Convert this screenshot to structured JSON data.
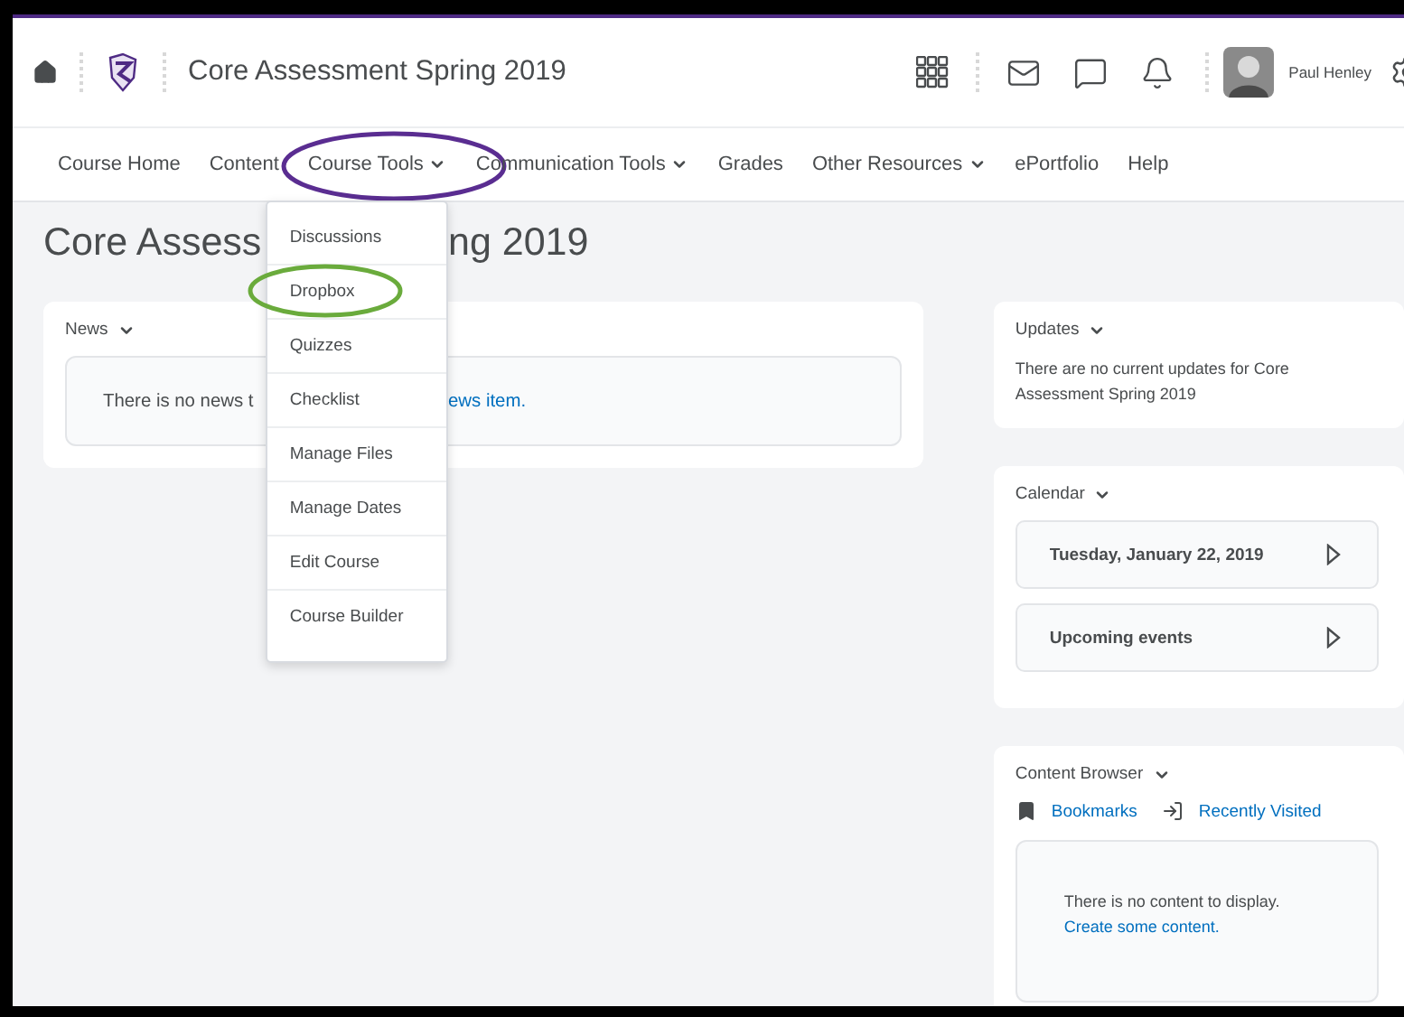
{
  "header": {
    "course_title": "Core Assessment Spring 2019",
    "user_name": "Paul Henley"
  },
  "nav": [
    {
      "label": "Course Home",
      "kind": "link",
      "expanded": false,
      "circled": false
    },
    {
      "label": "Content",
      "kind": "link",
      "expanded": false,
      "circled": false
    },
    {
      "label": "Course Tools",
      "kind": "menu",
      "expanded": true,
      "circled": true
    },
    {
      "label": "Communication Tools",
      "kind": "menu",
      "expanded": false,
      "circled": false
    },
    {
      "label": "Grades",
      "kind": "link",
      "expanded": false,
      "circled": false
    },
    {
      "label": "Other Resources",
      "kind": "menu",
      "expanded": false,
      "circled": false
    },
    {
      "label": "ePortfolio",
      "kind": "link",
      "expanded": false,
      "circled": false
    },
    {
      "label": "Help",
      "kind": "link",
      "expanded": false,
      "circled": false
    }
  ],
  "course_tools_menu": [
    {
      "label": "Discussions",
      "circled": false
    },
    {
      "label": "Dropbox",
      "circled": true
    },
    {
      "label": "Quizzes",
      "circled": false
    },
    {
      "label": "Checklist",
      "circled": false
    },
    {
      "label": "Manage Files",
      "circled": false
    },
    {
      "label": "Manage Dates",
      "circled": false
    },
    {
      "label": "Edit Course",
      "circled": false
    },
    {
      "label": "Course Builder",
      "circled": false
    }
  ],
  "page_heading": {
    "visible_parts": [
      "Core Assess",
      "ng 2019"
    ]
  },
  "news": {
    "title": "News",
    "message_start": "There is no news t",
    "message_link_end": "ews item."
  },
  "updates": {
    "title": "Updates",
    "message": "There are no current updates for Core Assessment Spring 2019"
  },
  "calendar": {
    "title": "Calendar",
    "rows": [
      "Tuesday, January 22, 2019",
      "Upcoming events"
    ]
  },
  "content_browser": {
    "title": "Content Browser",
    "tabs": [
      {
        "label": "Bookmarks",
        "kind": "bookmark"
      },
      {
        "label": "Recently Visited",
        "kind": "recent"
      }
    ],
    "message": "There is no content to display.",
    "link": "Create some content."
  }
}
